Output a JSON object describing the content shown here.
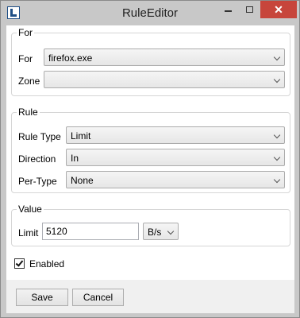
{
  "window": {
    "title": "RuleEditor",
    "close_glyph": "✕"
  },
  "for_group": {
    "legend": "For",
    "for_label": "For",
    "for_value": "firefox.exe",
    "zone_label": "Zone",
    "zone_value": ""
  },
  "rule_group": {
    "legend": "Rule",
    "rule_type_label": "Rule Type",
    "rule_type_value": "Limit",
    "direction_label": "Direction",
    "direction_value": "In",
    "per_type_label": "Per-Type",
    "per_type_value": "None"
  },
  "value_group": {
    "legend": "Value",
    "limit_label": "Limit",
    "limit_value": "5120",
    "unit_value": "B/s"
  },
  "enabled": {
    "label": "Enabled",
    "checked": true
  },
  "buttons": {
    "save": "Save",
    "cancel": "Cancel"
  }
}
